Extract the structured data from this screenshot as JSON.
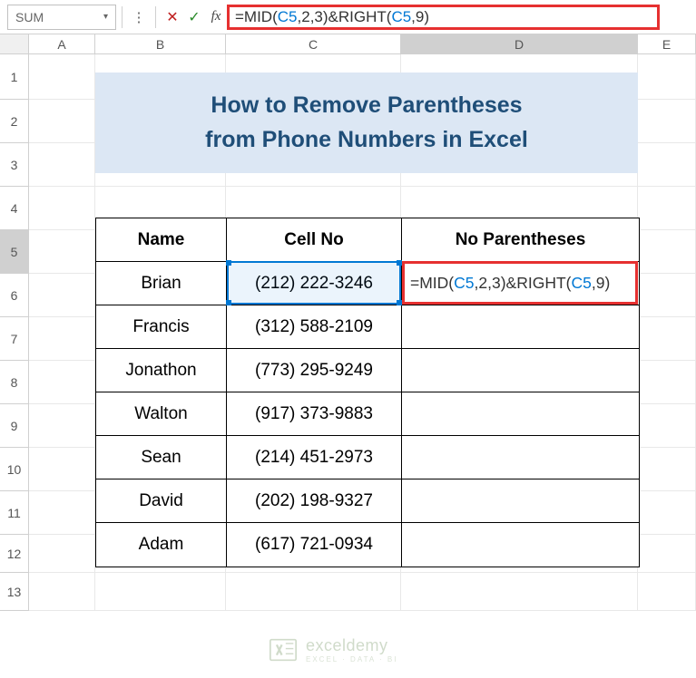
{
  "nameBox": "SUM",
  "formula": {
    "parts": [
      {
        "t": "=MID(",
        "cls": "fn-mid"
      },
      {
        "t": "C5",
        "cls": "fn-ref"
      },
      {
        "t": ",",
        "cls": "fn-mid"
      },
      {
        "t": "2",
        "cls": "fn-mid"
      },
      {
        "t": ",",
        "cls": "fn-mid"
      },
      {
        "t": "3",
        "cls": "fn-mid"
      },
      {
        "t": ")&RIGHT(",
        "cls": "fn-mid"
      },
      {
        "t": "C5",
        "cls": "fn-ref"
      },
      {
        "t": ",",
        "cls": "fn-mid"
      },
      {
        "t": "9",
        "cls": "fn-mid"
      },
      {
        "t": ")",
        "cls": "fn-mid"
      }
    ]
  },
  "columns": [
    "A",
    "B",
    "C",
    "D",
    "E"
  ],
  "rows": [
    "1",
    "2",
    "3",
    "4",
    "5",
    "6",
    "7",
    "8",
    "9",
    "10",
    "11",
    "12",
    "13"
  ],
  "title": {
    "line1": "How to Remove Parentheses",
    "line2": "from Phone Numbers in Excel"
  },
  "headers": {
    "name": "Name",
    "cell": "Cell No",
    "noparen": "No Parentheses"
  },
  "data": [
    {
      "name": "Brian",
      "cell": "(212) 222-3246"
    },
    {
      "name": "Francis",
      "cell": "(312) 588-2109"
    },
    {
      "name": "Jonathon",
      "cell": "(773) 295-9249"
    },
    {
      "name": "Walton",
      "cell": "(917) 373-9883"
    },
    {
      "name": "Sean",
      "cell": "(214) 451-2973"
    },
    {
      "name": "David",
      "cell": "(202) 198-9327"
    },
    {
      "name": "Adam",
      "cell": "(617) 721-0934"
    }
  ],
  "watermark": {
    "text": "exceldemy",
    "sub": "EXCEL · DATA · BI"
  },
  "chart_data": {
    "type": "table",
    "title": "How to Remove Parentheses from Phone Numbers in Excel",
    "columns": [
      "Name",
      "Cell No",
      "No Parentheses"
    ],
    "rows": [
      [
        "Brian",
        "(212) 222-3246",
        "=MID(C5,2,3)&RIGHT(C5,9)"
      ],
      [
        "Francis",
        "(312) 588-2109",
        ""
      ],
      [
        "Jonathon",
        "(773) 295-9249",
        ""
      ],
      [
        "Walton",
        "(917) 373-9883",
        ""
      ],
      [
        "Sean",
        "(214) 451-2973",
        ""
      ],
      [
        "David",
        "(202) 198-9327",
        ""
      ],
      [
        "Adam",
        "(617) 721-0934",
        ""
      ]
    ]
  }
}
